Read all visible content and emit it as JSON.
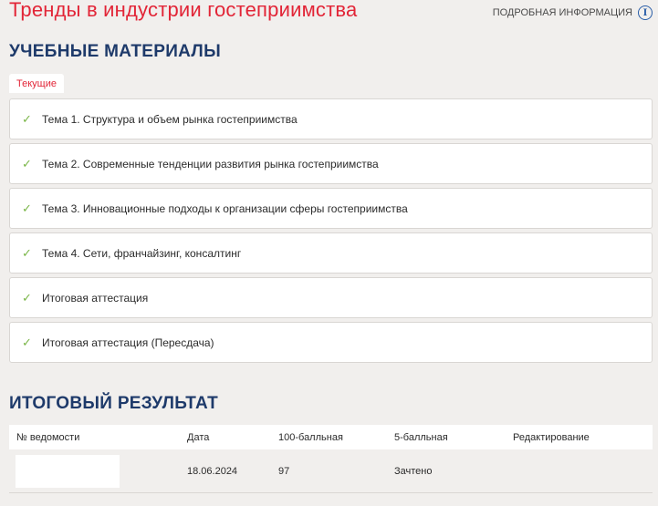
{
  "header": {
    "title": "Тренды в индустрии гостеприимства",
    "info_label": "ПОДРОБНАЯ ИНФОРМАЦИЯ",
    "info_icon": "info-icon"
  },
  "materials": {
    "heading": "УЧЕБНЫЕ МАТЕРИАЛЫ",
    "tab_label": "Текущие",
    "items": [
      {
        "label": "Тема 1. Структура и объем рынка гостеприимства",
        "icon": "check-icon"
      },
      {
        "label": "Тема 2. Современные тенденции развития рынка гостеприимства",
        "icon": "check-icon"
      },
      {
        "label": "Тема 3. Инновационные подходы к организации сферы гостеприимства",
        "icon": "check-icon"
      },
      {
        "label": "Тема 4. Сети, франчайзинг, консалтинг",
        "icon": "check-icon"
      },
      {
        "label": "Итоговая аттестация",
        "icon": "check-icon"
      },
      {
        "label": "Итоговая аттестация (Пересдача)",
        "icon": "check-icon"
      }
    ]
  },
  "results": {
    "heading": "ИТОГОВЫЙ РЕЗУЛЬТАТ",
    "columns": [
      "№ ведомости",
      "Дата",
      "100-балльная",
      "5-балльная",
      "Редактирование"
    ],
    "rows": [
      {
        "statement_no": "",
        "date": "18.06.2024",
        "score100": "97",
        "score5": "Зачтено",
        "edit": ""
      }
    ]
  },
  "colors": {
    "accent_red": "#e22537",
    "heading_blue": "#1e3a6a",
    "check_green": "#7ab648",
    "info_blue": "#2a5ea8",
    "background": "#f1efed"
  }
}
